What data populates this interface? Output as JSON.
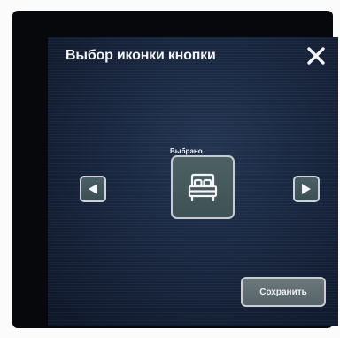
{
  "dialog": {
    "title": "Выбор иконки кнопки",
    "close_icon": "close-icon",
    "selected_label": "Выбрано",
    "selected_icon": "bed-icon",
    "prev_icon": "arrow-left-icon",
    "next_icon": "arrow-right-icon",
    "save_label": "Сохранить"
  },
  "colors": {
    "background": "#18263f",
    "button_fill": "#4b5f66",
    "button_border": "#cfd3d9",
    "text": "#f2f4f8"
  }
}
